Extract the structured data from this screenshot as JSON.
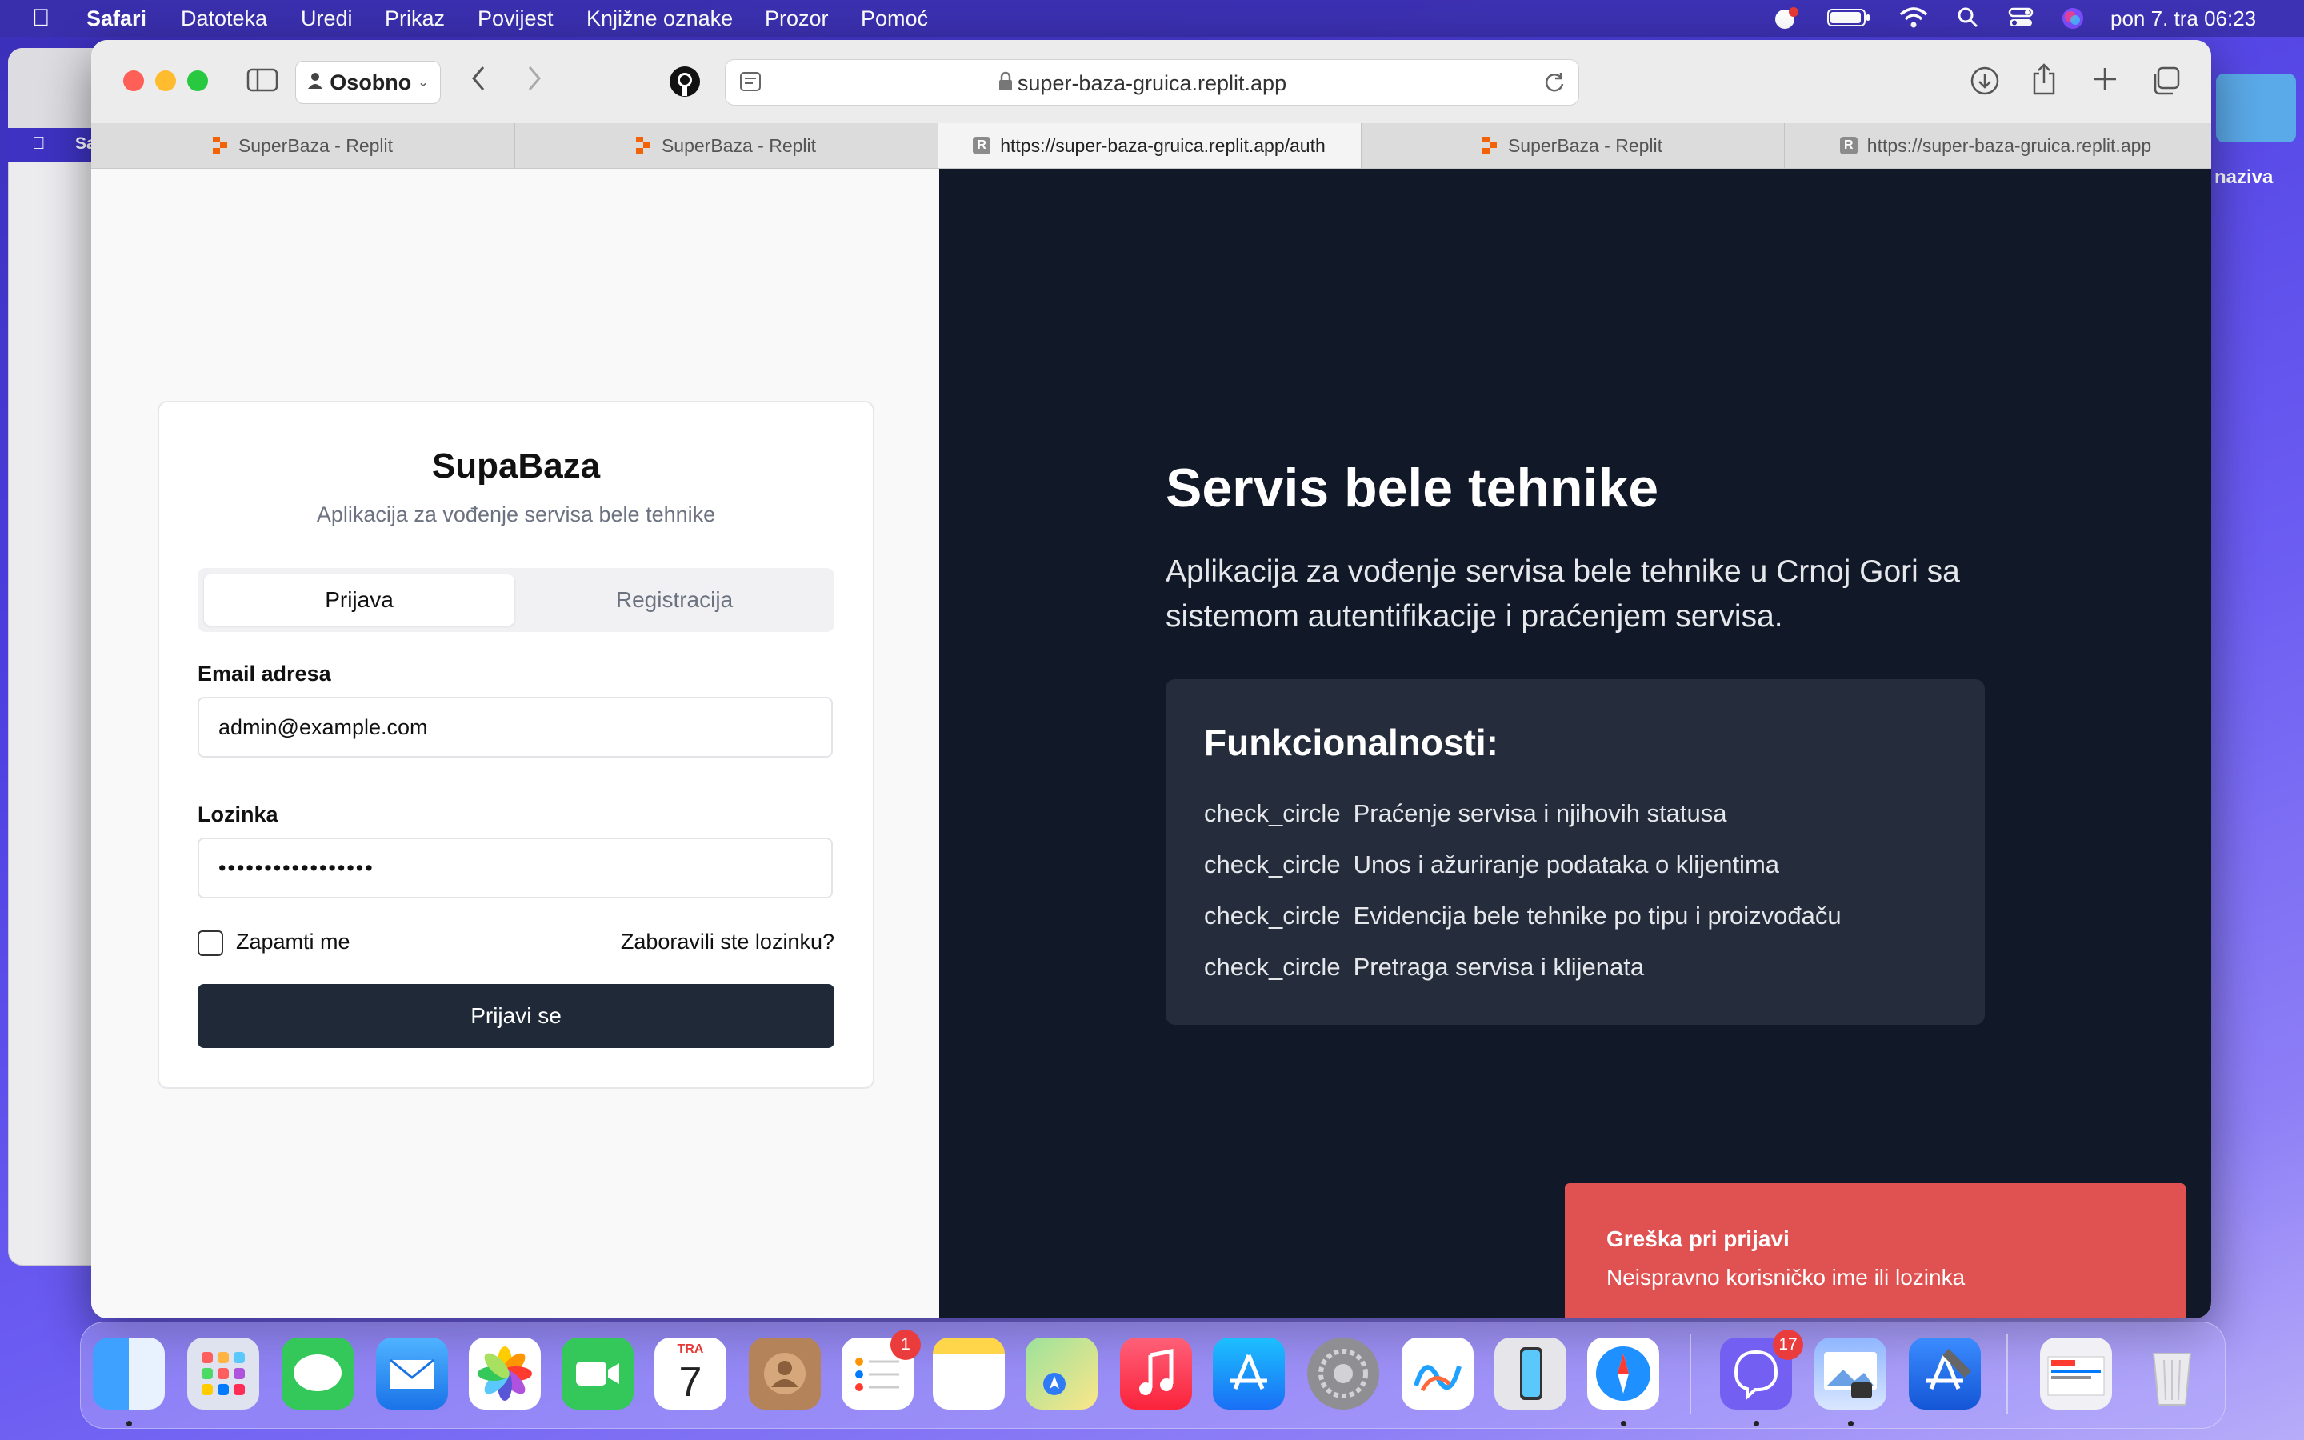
{
  "menubar": {
    "app": "Safari",
    "items": [
      "Datoteka",
      "Uredi",
      "Prikaz",
      "Povijest",
      "Knjižne oznake",
      "Prozor",
      "Pomoć"
    ],
    "clock": "pon 7. tra  06:23"
  },
  "desktop": {
    "folder_label": "naziva",
    "bg_window_label": "Sa"
  },
  "browser": {
    "profile": "Osobno",
    "url": "super-baza-gruica.replit.app",
    "tabs": [
      {
        "title": "SuperBaza - Replit",
        "favicon": "replit-icon"
      },
      {
        "title": "SuperBaza - Replit",
        "favicon": "replit-icon"
      },
      {
        "title": "https://super-baza-gruica.replit.app/auth",
        "favicon": "r-letter-icon",
        "active": true
      },
      {
        "title": "SuperBaza - Replit",
        "favicon": "replit-icon"
      },
      {
        "title": "https://super-baza-gruica.replit.app",
        "favicon": "r-letter-icon"
      }
    ]
  },
  "auth": {
    "title": "SupaBaza",
    "subtitle": "Aplikacija za vođenje servisa bele tehnike",
    "tab_login": "Prijava",
    "tab_register": "Registracija",
    "email_label": "Email adresa",
    "email_value": "admin@example.com",
    "password_label": "Lozinka",
    "password_value": "•••••••••••••••••",
    "remember_label": "Zapamti me",
    "forgot_link": "Zaboravili ste lozinku?",
    "submit_label": "Prijavi se"
  },
  "hero": {
    "title": "Servis bele tehnike",
    "text": "Aplikacija za vođenje servisa bele tehnike u Crnoj Gori sa sistemom autentifikacije i praćenjem servisa.",
    "features_title": "Funkcionalnosti:",
    "feature_icon_text": "check_circle",
    "features": [
      "Praćenje servisa i njihovih statusa",
      "Unos i ažuriranje podataka o klijentima",
      "Evidencija bele tehnike po tipu i proizvođaču",
      "Pretraga servisa i klijenata"
    ]
  },
  "toast": {
    "title": "Greška pri prijavi",
    "message": "Neispravno korisničko ime ili lozinka"
  },
  "dock": {
    "calendar_month": "TRA",
    "calendar_day": "7",
    "reminders_badge": "1",
    "viber_badge": "17"
  },
  "colors": {
    "dark_panel": "#111827",
    "feature_box": "#252c3b",
    "toast_bg": "#e05252",
    "button_bg": "#1f2937"
  }
}
